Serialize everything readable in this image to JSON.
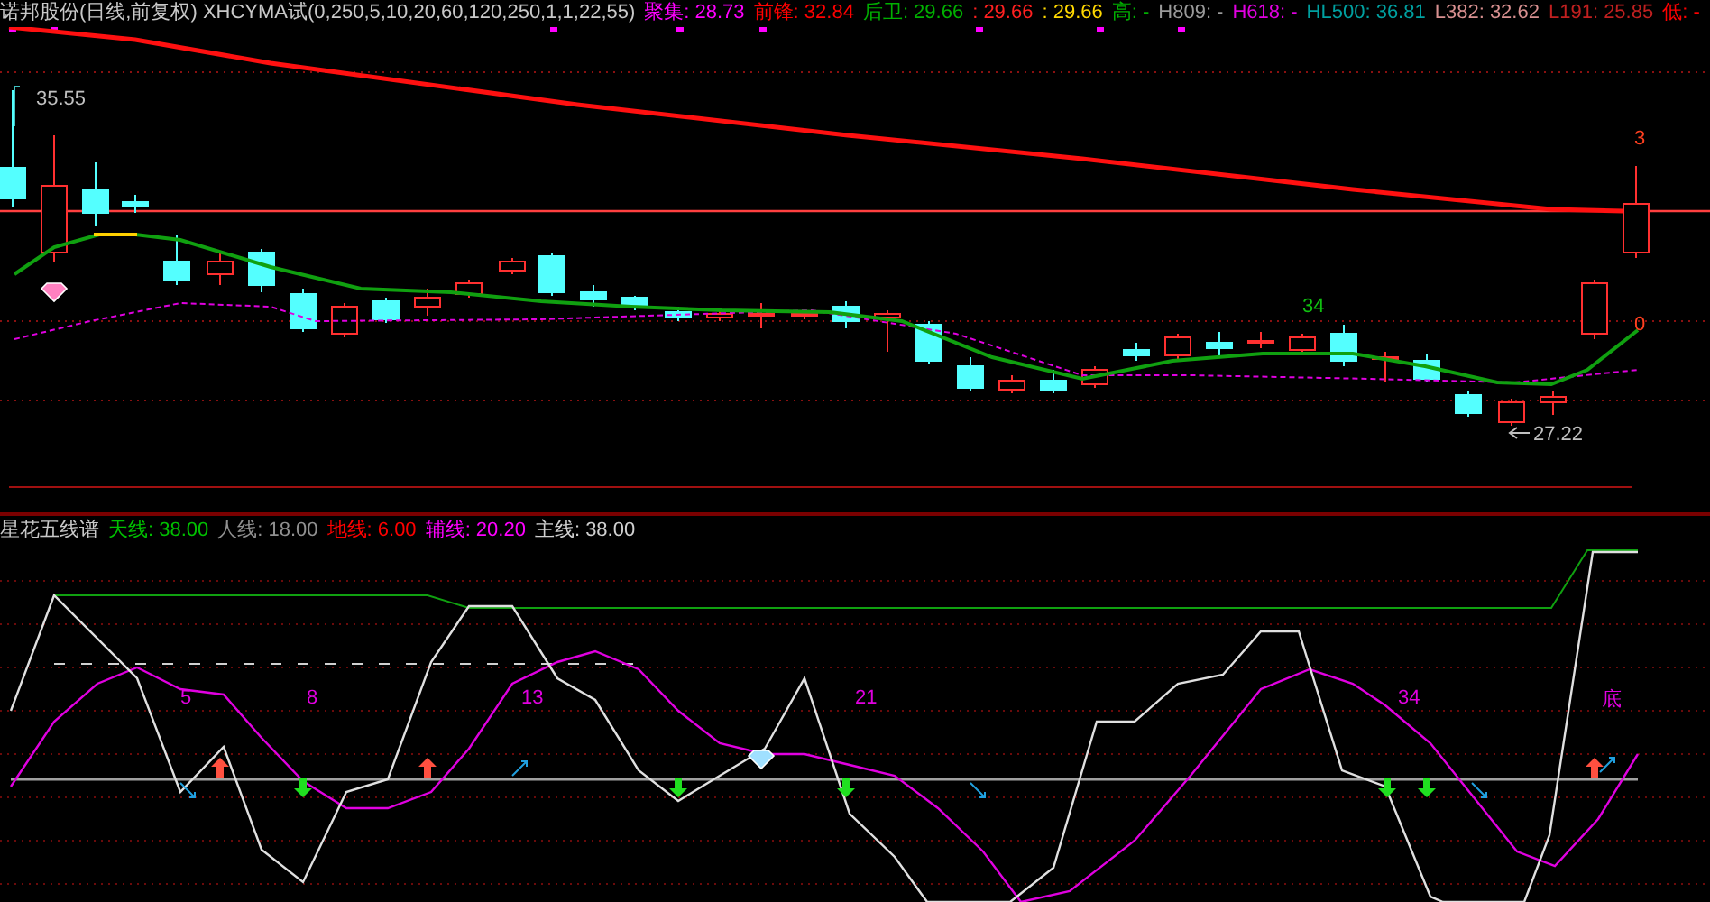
{
  "price_panel": {
    "title": "诺邦股份(日线,前复权) XHCYMA试(0,250,5,10,20,60,120,250,1,1,22,55)",
    "indicators": [
      {
        "text": "聚集: 28.73",
        "color": "#ff00ff"
      },
      {
        "text": "前锋: 32.84",
        "color": "#ff0000"
      },
      {
        "text": "后卫: 29.66",
        "color": "#00b000"
      },
      {
        "text": ": 29.66",
        "color": "#ff2020"
      },
      {
        "text": ": 29.66",
        "color": "#ffd800"
      },
      {
        "text": "高: -",
        "color": "#00b000"
      },
      {
        "text": "H809: -",
        "color": "#9a9a9a"
      },
      {
        "text": "H618: -",
        "color": "#e000e0"
      },
      {
        "text": "HL500: 36.81",
        "color": "#00a0a0"
      },
      {
        "text": "L382: 32.62",
        "color": "#d89090"
      },
      {
        "text": "L191: 25.85",
        "color": "#c02020"
      },
      {
        "text": "低: -",
        "color": "#ff0000"
      }
    ],
    "labels": {
      "high_price": "35.55",
      "low_price": "27.22",
      "cycle_count": "34",
      "counter_upper": "3",
      "counter_lower": "0"
    }
  },
  "oscillator_panel": {
    "title": "星花五线谱",
    "indicators": [
      {
        "text": "天线: 38.00",
        "color": "#00c000"
      },
      {
        "text": "人线: 18.00",
        "color": "#909090"
      },
      {
        "text": "地线: 6.00",
        "color": "#ff0000"
      },
      {
        "text": "辅线: 20.20",
        "color": "#ff00ff"
      },
      {
        "text": "主线: 38.00",
        "color": "#d0d0d0"
      }
    ],
    "cycle_labels": [
      "5",
      "8",
      "13",
      "21",
      "34",
      "底"
    ]
  }
}
